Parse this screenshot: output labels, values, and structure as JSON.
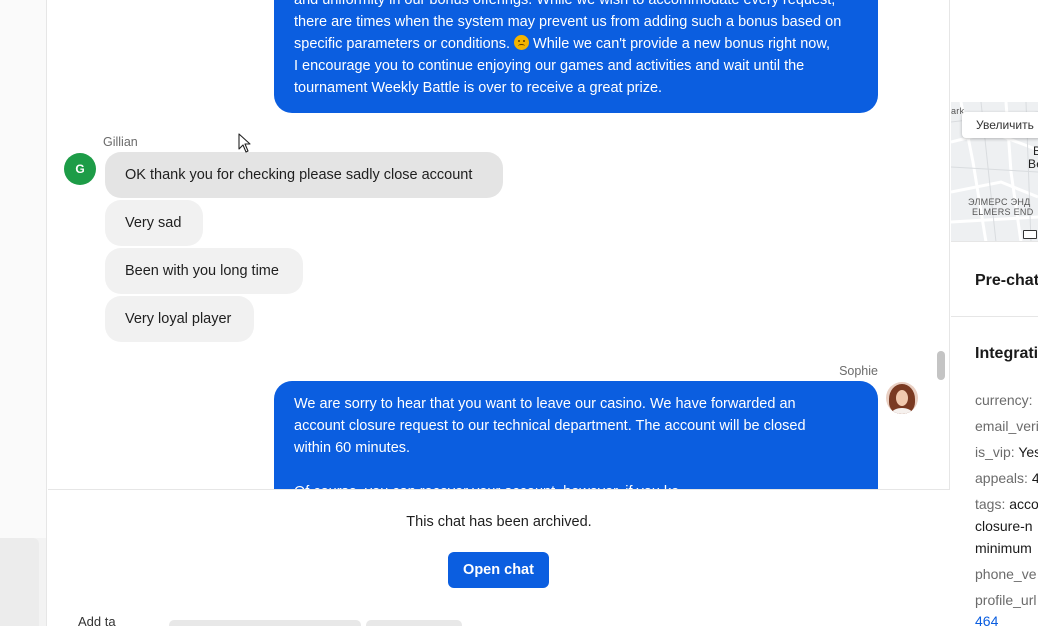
{
  "chat": {
    "agent_message_top": {
      "lines": [
        "and uniformity in our bonus offerings. While we wish to accommodate every request,",
        "there are times when the system may prevent us from adding such a bonus based on",
        "specific parameters or conditions.",
        " While we can't provide a new bonus right now,",
        "I encourage you to continue enjoying our games and activities and wait until the",
        "tournament Weekly Battle is over to receive a great prize."
      ]
    },
    "customer": {
      "name": "Gillian",
      "avatar_initial": "G",
      "avatar_color": "#1d9c47",
      "messages": [
        "OK thank you for checking please sadly close account",
        "Very sad",
        "Been with you long time",
        "Very loyal player"
      ]
    },
    "agent": {
      "name": "Sophie",
      "message": {
        "line1": "We are sorry to hear that you want to leave our casino. We have forwarded an",
        "line2": "account closure request to our technical department. The account will be closed",
        "line3": "within 60 minutes.",
        "line4": "Of course, you can recover your account, however, if you ke..."
      }
    },
    "archive": {
      "notice": "This chat has been archived.",
      "open_chat_label": "Open chat",
      "add_label": "Add ta"
    },
    "colors": {
      "agent_bubble": "#0b5ee0",
      "customer_bubble": "#f1f1f1",
      "button": "#0b5ee0"
    }
  },
  "sidebar": {
    "map": {
      "zoom_label": "Увеличить",
      "label_top_left": "ark",
      "label_right_1": "B",
      "label_right_2": "Be",
      "district_ru": "ЭЛМЕРС ЭНД",
      "district_en": "ELMERS END"
    },
    "prechat_title": "Pre-chat",
    "integrations_title": "Integrati",
    "fields": {
      "currency_key": "currency:",
      "email_key": "email_veri",
      "is_vip_key": "is_vip:",
      "is_vip_value": "Yes",
      "appeals_key": "appeals:",
      "appeals_value": "4",
      "tags_key": "tags:",
      "tags_value_1": "acco",
      "tags_value_2": "closure-n",
      "tags_value_3": "minimum",
      "phone_key": "phone_ve",
      "profile_key": "profile_url",
      "profile_value": "464"
    }
  }
}
